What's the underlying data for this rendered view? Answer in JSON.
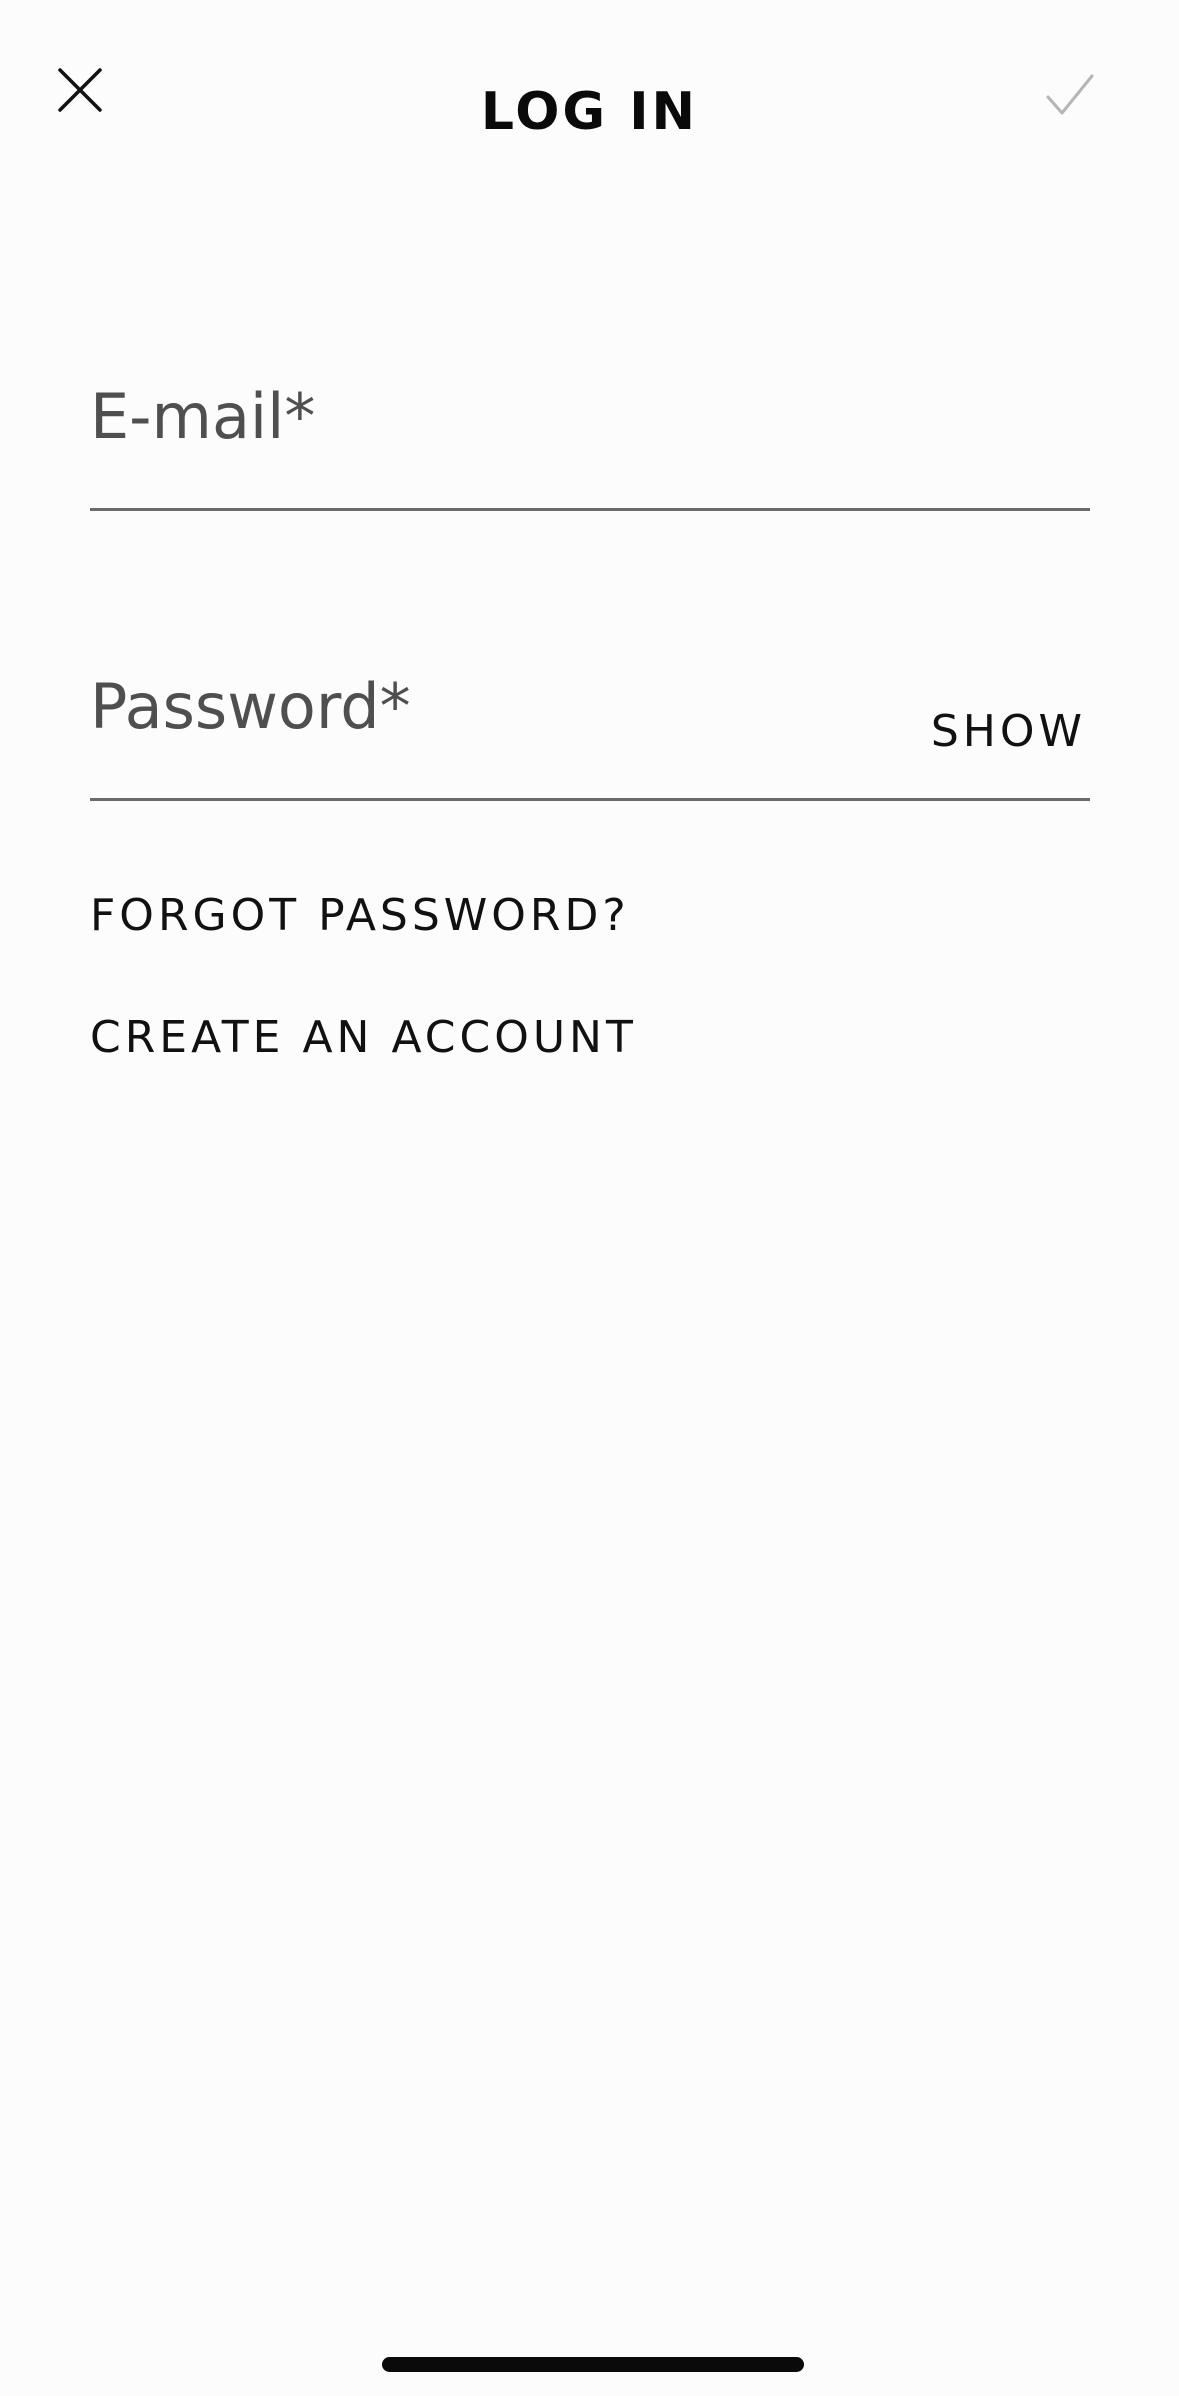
{
  "header": {
    "title": "LOG IN",
    "close_icon": "close-icon",
    "confirm_icon": "checkmark-icon"
  },
  "form": {
    "email": {
      "label": "E-mail*",
      "value": ""
    },
    "password": {
      "label": "Password*",
      "value": "",
      "show_label": "SHOW"
    }
  },
  "links": {
    "forgot_password": "FORGOT PASSWORD?",
    "create_account": "CREATE AN ACCOUNT"
  },
  "colors": {
    "background": "#fdfcfc",
    "text": "#111111",
    "placeholder": "#4f4f4f",
    "underline": "#6b6b6b",
    "confirm_disabled": "#b5b5b5"
  }
}
